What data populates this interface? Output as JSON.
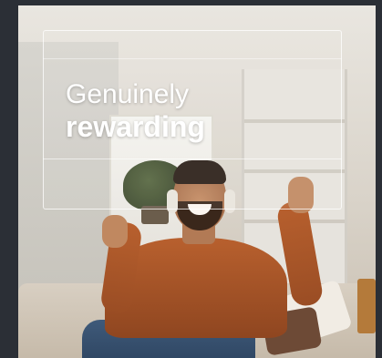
{
  "hero": {
    "headline_line1": "Genuinely",
    "headline_line2": "rewarding"
  },
  "colors": {
    "page_background": "#2b2f36",
    "headline_text": "#ffffff",
    "shirt": "#b8602e"
  },
  "image": {
    "icon": "photo"
  }
}
